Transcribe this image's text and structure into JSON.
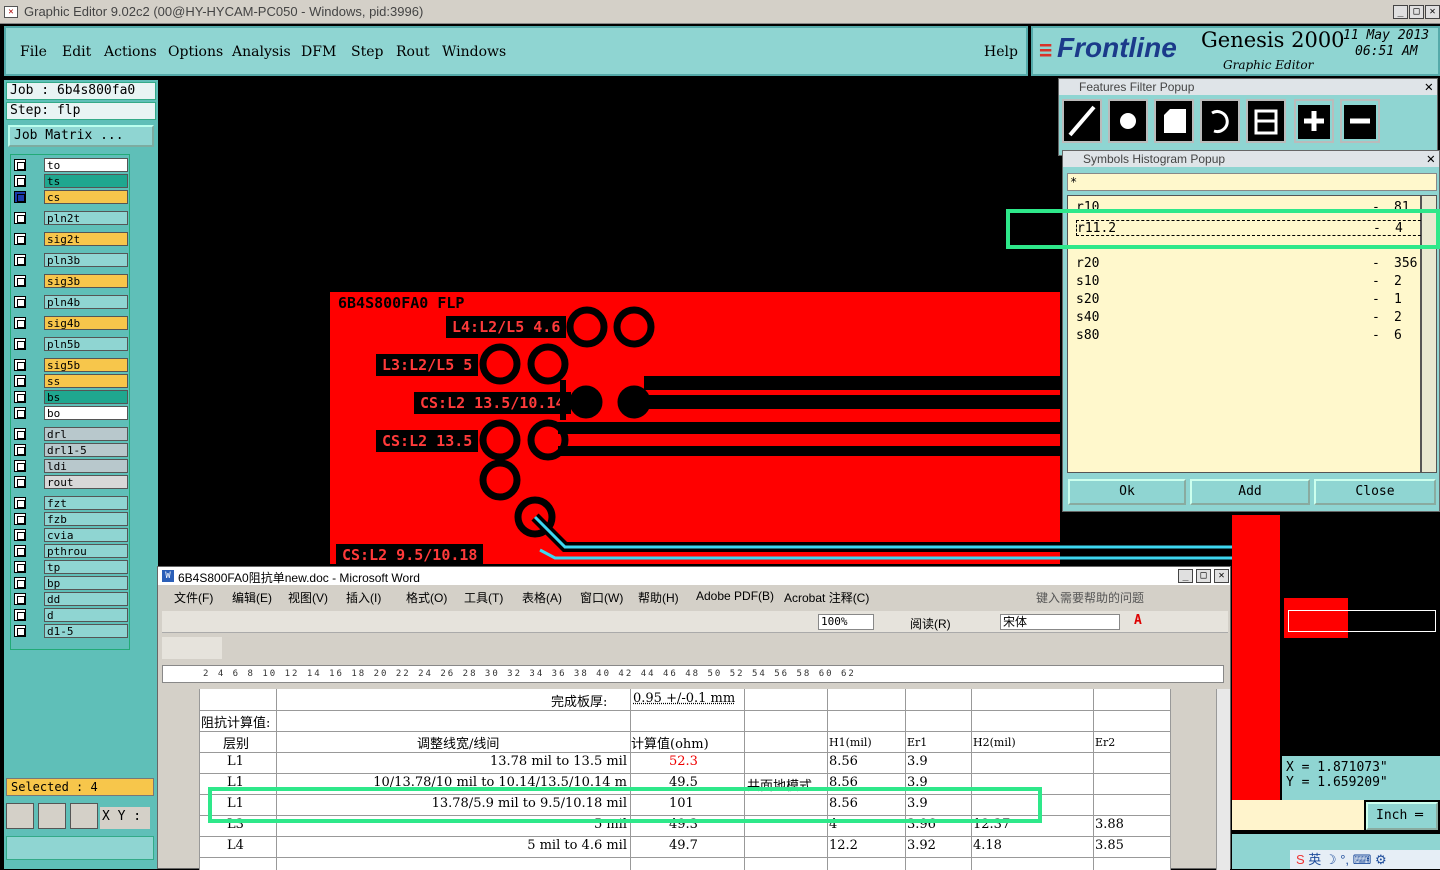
{
  "window": {
    "title": "Graphic Editor 9.02c2 (00@HY-HYCAM-PC050 - Windows, pid:3996)"
  },
  "menu": {
    "items": [
      "File",
      "Edit",
      "Actions",
      "Options",
      "Analysis",
      "DFM",
      "Step",
      "Rout",
      "Windows"
    ],
    "help": "Help"
  },
  "brand": {
    "logo": "Frontline",
    "product": "Genesis 2000",
    "subtitle": "Graphic Editor",
    "date": "11 May 2013",
    "time": "06:51 AM"
  },
  "job": {
    "job_label": "Job : 6b4s800fa0",
    "step_label": "Step: flp",
    "matrix_button": "Job Matrix ..."
  },
  "layers": [
    {
      "name": "to",
      "color": "#ffffff"
    },
    {
      "name": "ts",
      "color": "#1fa78f"
    },
    {
      "name": "cs",
      "color": "#f7c64b"
    },
    {
      "name": "pln2t",
      "color": "#8fd5d2"
    },
    {
      "name": "sig2t",
      "color": "#f7c64b"
    },
    {
      "name": "pln3b",
      "color": "#8fd5d2"
    },
    {
      "name": "sig3b",
      "color": "#f7c64b"
    },
    {
      "name": "pln4b",
      "color": "#8fd5d2"
    },
    {
      "name": "sig4b",
      "color": "#f7c64b"
    },
    {
      "name": "pln5b",
      "color": "#8fd5d2"
    },
    {
      "name": "sig5b",
      "color": "#f7c64b"
    },
    {
      "name": "ss",
      "color": "#f7c64b"
    },
    {
      "name": "bs",
      "color": "#1fa78f"
    },
    {
      "name": "bo",
      "color": "#ffffff"
    },
    {
      "name": "drl",
      "color": "#b8c8cc"
    },
    {
      "name": "drl1-5",
      "color": "#b8c8cc"
    },
    {
      "name": "ldi",
      "color": "#b8c8cc"
    },
    {
      "name": "rout",
      "color": "#d8d8d8"
    },
    {
      "name": "fzt",
      "color": "#8fd5d2"
    },
    {
      "name": "fzb",
      "color": "#8fd5d2"
    },
    {
      "name": "cvia",
      "color": "#8fd5d2"
    },
    {
      "name": "pthrou",
      "color": "#8fd5d2"
    },
    {
      "name": "tp",
      "color": "#8fd5d2"
    },
    {
      "name": "bp",
      "color": "#8fd5d2"
    },
    {
      "name": "dd",
      "color": "#8fd5d2"
    },
    {
      "name": "d",
      "color": "#8fd5d2"
    },
    {
      "name": "d1-5",
      "color": "#8fd5d2"
    }
  ],
  "status": {
    "selected": "Selected : 4",
    "xy_label": "X Y :",
    "coord_x": "X = 1.871073\"",
    "coord_y": "Y = 1.659209\"",
    "unit": "Inch"
  },
  "pcb": {
    "title": "6B4S800FA0 FLP",
    "labels": [
      "L4:L2/L5 4.6",
      "L3:L2/L5 5",
      "CS:L2 13.5/10.14",
      "CS:L2 13.5",
      "CS:L2 9.5/10.18"
    ]
  },
  "filter_popup": {
    "title": "Features Filter Popup"
  },
  "histogram": {
    "title": "Symbols Histogram Popup",
    "filter": "*",
    "rows": [
      {
        "sym": "r10",
        "cnt": "81"
      },
      {
        "sym": "r11.2",
        "cnt": "4"
      },
      {
        "sym": "r20",
        "cnt": "356"
      },
      {
        "sym": "s10",
        "cnt": "2"
      },
      {
        "sym": "s20",
        "cnt": "1"
      },
      {
        "sym": "s40",
        "cnt": "2"
      },
      {
        "sym": "s80",
        "cnt": "6"
      }
    ],
    "ok": "Ok",
    "add": "Add",
    "close": "Close"
  },
  "word": {
    "title": "6B4S800FA0阻抗单new.doc - Microsoft Word",
    "menu": [
      "文件(F)",
      "编辑(E)",
      "视图(V)",
      "插入(I)",
      "格式(O)",
      "工具(T)",
      "表格(A)",
      "窗口(W)",
      "帮助(H)",
      "Adobe PDF(B)",
      "Acrobat 注释(C)"
    ],
    "help_placeholder": "键入需要帮助的问题",
    "zoom": "100%",
    "read": "阅读(R)",
    "font": "宋体",
    "ruler": "2 4 6 8 10 12 14 16 18 20 22 24 26 28 30 32 34 36 38 40 42 44 46 48 50 52 54 56 58 60 62",
    "board_thick_label": "完成板厚:",
    "board_thick_val": "0.95 +/-0.1 mm",
    "calc_title": "阻抗计算值:",
    "headers": {
      "layer": "层别",
      "width": "调整线宽/线间",
      "calc": "计算值(ohm)",
      "h1": "H1(mil)",
      "er1": "Er1",
      "h2": "H2(mil)",
      "er2": "Er2"
    },
    "rows": [
      {
        "layer": "L1",
        "width": "13.78 mil to 13.5 mil",
        "calc": "52.3",
        "mode": "",
        "h1": "8.56",
        "er1": "3.9",
        "h2": "",
        "er2": ""
      },
      {
        "layer": "L1",
        "width": "10/13.78/10 mil to 10.14/13.5/10.14 m",
        "calc": "49.5",
        "mode": "共面地模式",
        "h1": "8.56",
        "er1": "3.9",
        "h2": "",
        "er2": ""
      },
      {
        "layer": "L1",
        "width": "13.78/5.9 mil to 9.5/10.18 mil",
        "calc": "101",
        "mode": "",
        "h1": "8.56",
        "er1": "3.9",
        "h2": "",
        "er2": ""
      },
      {
        "layer": "L3",
        "width": "5 mil",
        "calc": "49.3",
        "mode": "",
        "h1": "4",
        "er1": "3.96",
        "h2": "12.37",
        "er2": "3.88"
      },
      {
        "layer": "L4",
        "width": "5 mil to 4.6 mil",
        "calc": "49.7",
        "mode": "",
        "h1": "12.2",
        "er1": "3.92",
        "h2": "4.18",
        "er2": "3.85"
      }
    ]
  },
  "ime": {
    "label": "英"
  },
  "colors": {
    "pcb_red": "#ff0000",
    "highlight": "#2ee88a",
    "trace_cyan": "#3ed7f0"
  }
}
